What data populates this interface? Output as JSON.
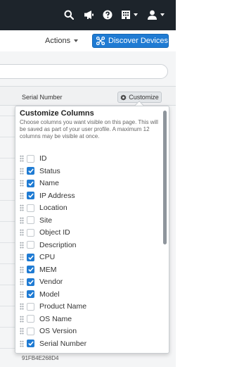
{
  "topbar": {
    "icons": [
      "search-icon",
      "megaphone-icon",
      "help-icon",
      "building-icon",
      "user-icon"
    ]
  },
  "toolbar": {
    "actions_label": "Actions",
    "discover_label": "Discover Devices"
  },
  "table": {
    "column_header": "Serial Number",
    "customize_label": "Customize",
    "last_row_serial": "91FB4E268D4"
  },
  "popover": {
    "title": "Customize Columns",
    "description": "Choose columns you want visible on this page. This will be saved as part of your user profile. A maximum 12 columns may be visible at once.",
    "columns": [
      {
        "label": "ID",
        "checked": false
      },
      {
        "label": "Status",
        "checked": true
      },
      {
        "label": "Name",
        "checked": true
      },
      {
        "label": "IP Address",
        "checked": true
      },
      {
        "label": "Location",
        "checked": false
      },
      {
        "label": "Site",
        "checked": false
      },
      {
        "label": "Object ID",
        "checked": false
      },
      {
        "label": "Description",
        "checked": false
      },
      {
        "label": "CPU",
        "checked": true
      },
      {
        "label": "MEM",
        "checked": true
      },
      {
        "label": "Vendor",
        "checked": true
      },
      {
        "label": "Model",
        "checked": true
      },
      {
        "label": "Product Name",
        "checked": false
      },
      {
        "label": "OS Name",
        "checked": false
      },
      {
        "label": "OS Version",
        "checked": false
      },
      {
        "label": "Serial Number",
        "checked": true
      }
    ]
  },
  "colors": {
    "topbar": "#1d242b",
    "accent": "#1f7bd3"
  }
}
